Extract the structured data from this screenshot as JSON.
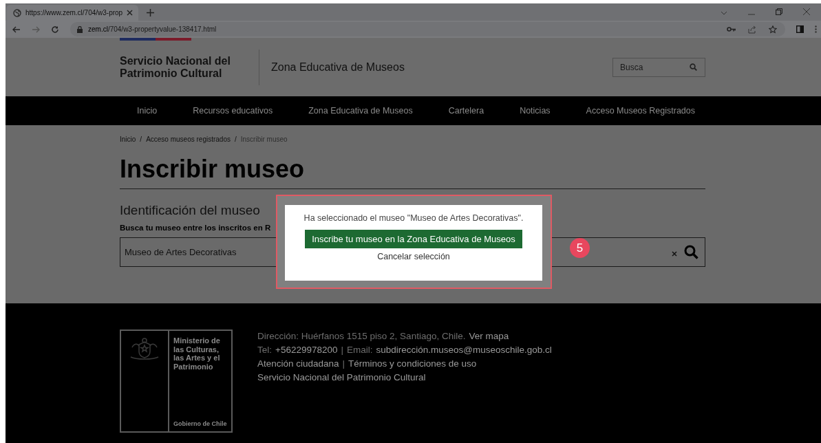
{
  "browser": {
    "tab_title": "https://www.zem.cl/704/w3-prop",
    "url_host": "zem.cl",
    "url_path": "/704/w3-propertyvalue-138417.html"
  },
  "header": {
    "org_name": "Servicio Nacional del Patrimonio Cultural",
    "site_title": "Zona Educativa de Museos",
    "search": {
      "placeholder": "Busca"
    }
  },
  "nav": {
    "items": [
      {
        "label": "Inicio"
      },
      {
        "label": "Recursos educativos"
      },
      {
        "label": "Zona Educativa de Museos"
      },
      {
        "label": "Cartelera"
      },
      {
        "label": "Noticias"
      },
      {
        "label": "Acceso Museos Registrados"
      }
    ]
  },
  "breadcrumb": {
    "separator": "/",
    "items": [
      {
        "label": "Inicio",
        "current": false
      },
      {
        "label": "Acceso museos registrados",
        "current": false
      },
      {
        "label": "Inscribir museo",
        "current": true
      }
    ]
  },
  "page_title": "Inscribir museo",
  "section_title": "Identificación del museo",
  "search_label": "Busca tu museo entre los inscritos en R",
  "museum_search": {
    "value": "Museo de Artes Decorativas"
  },
  "dialog": {
    "message": "Ha seleccionado el museo \"Museo de Artes Decorativas\".",
    "primary_button": "Inscribe tu museo en la Zona Educativa de Museos",
    "cancel_link": "Cancelar selección"
  },
  "step_badge": "5",
  "footer": {
    "logo": {
      "ministry": "Ministerio de las Culturas, las Artes y el Patrimonio",
      "government": "Gobierno de Chile"
    },
    "lines": [
      [
        {
          "kind": "label",
          "text": "Dirección: Huérfanos 1515 piso 2, Santiago, Chile."
        },
        {
          "kind": "link",
          "text": "Ver mapa"
        }
      ],
      [
        {
          "kind": "label",
          "text": "Tel:"
        },
        {
          "kind": "link",
          "text": "+56229978200"
        },
        {
          "kind": "separator",
          "text": "|"
        },
        {
          "kind": "label",
          "text": "Email:"
        },
        {
          "kind": "link",
          "text": "subdirección.museos@museoschile.gob.cl"
        }
      ],
      [
        {
          "kind": "link",
          "text": "Atención ciudadana"
        },
        {
          "kind": "separator",
          "text": "|"
        },
        {
          "kind": "link",
          "text": "Términos y condiciones de uso"
        }
      ],
      [
        {
          "kind": "link",
          "text": "Servicio Nacional del Patrimonio Cultural"
        }
      ]
    ]
  }
}
